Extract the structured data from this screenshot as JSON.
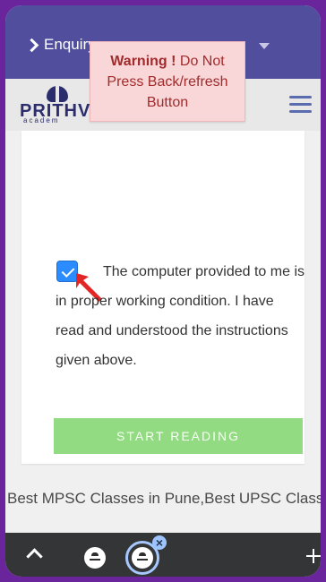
{
  "header": {
    "enquiry_label": "Enquiry",
    "warning_title": "Warning !",
    "warning_message": "Do Not Press Back/refresh Button",
    "logo_text": "PRITHV",
    "logo_subtext": "academ"
  },
  "main": {
    "agreement_text": "The computer provided to me is in proper working condition. I have read and understood the instructions given above.",
    "checkbox_state": "checked",
    "start_button_label": "START READING"
  },
  "footer": {
    "text": "Best MPSC Classes in Pune,Best UPSC Classes in Pune,Best MPSC UPSC Classes in"
  },
  "colors": {
    "primary_header": "#514f9d",
    "warning_background": "#f9d7d9",
    "warning_text": "#a12b2b",
    "checkbox_blue": "#2b8cff",
    "button_green": "#93db83",
    "arrow_red": "#e22525",
    "bottom_nav": "#343536"
  },
  "icons": {
    "enquiry_chevron": "chevron-right-icon",
    "dropdown": "chevron-down-icon",
    "menu": "hamburger-menu-icon",
    "checkbox": "check-icon",
    "pointer": "red-arrow-icon",
    "tabs": "profile-icon",
    "close_tab": "close-icon",
    "new_tab": "plus-icon"
  }
}
